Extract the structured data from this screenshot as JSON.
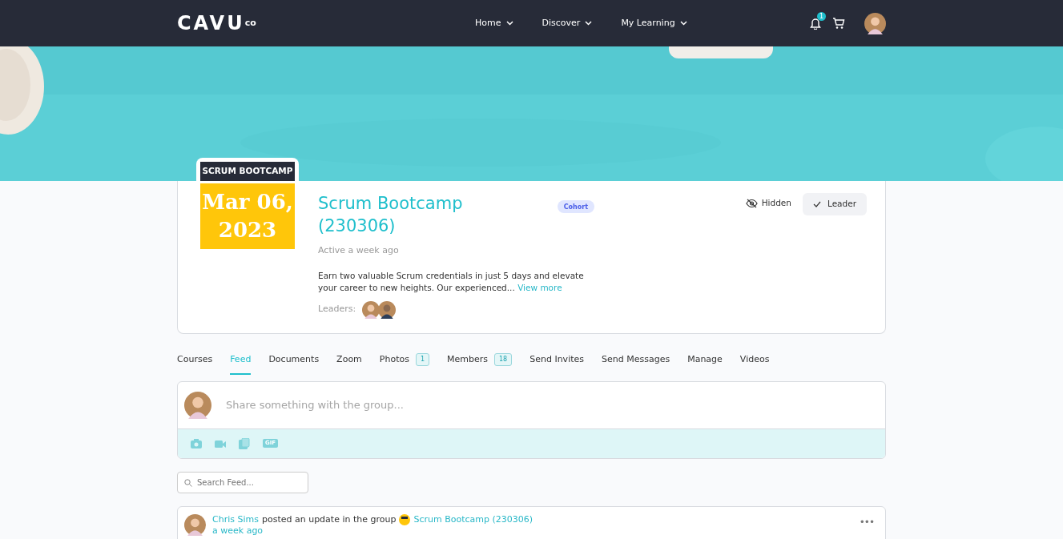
{
  "navbar": {
    "logo": "CAVU",
    "logo_sup": "co",
    "menu": [
      {
        "label": "Home"
      },
      {
        "label": "Discover"
      },
      {
        "label": "My Learning"
      }
    ],
    "notifications": "1"
  },
  "group": {
    "date_label": "SCRUM BOOTCAMP",
    "date": "Mar 06, 2023",
    "title": "Scrum Bootcamp (230306)",
    "type": "Cohort",
    "activity": "Active a week ago",
    "description": "Earn two valuable Scrum credentials in just 5 days and elevate your career to new heights. Our experienced...",
    "more": "View more",
    "leaders_label": "Leaders:",
    "hidden": "Hidden",
    "role": "Leader"
  },
  "tabs": [
    {
      "label": "Courses",
      "selected": false
    },
    {
      "label": "Feed",
      "selected": true
    },
    {
      "label": "Documents",
      "selected": false
    },
    {
      "label": "Zoom",
      "selected": false
    },
    {
      "label": "Photos",
      "count": "1",
      "selected": false
    },
    {
      "label": "Members",
      "count": "18",
      "selected": false
    },
    {
      "label": "Send Invites",
      "selected": false
    },
    {
      "label": "Send Messages",
      "selected": false
    },
    {
      "label": "Manage",
      "selected": false
    },
    {
      "label": "Videos",
      "selected": false
    }
  ],
  "composer": {
    "placeholder": "Share something with the group...",
    "tools": [
      {
        "kind": "camera"
      },
      {
        "kind": "video"
      },
      {
        "kind": "document"
      },
      {
        "kind": "gif",
        "label": "GIF"
      }
    ]
  },
  "search": {
    "placeholder": "Search Feed..."
  },
  "post": {
    "author": "Chris Sims",
    "action": "posted an update in the group",
    "group": "Scrum Bootcamp (230306)",
    "time": "a week ago",
    "menu": "•••"
  }
}
